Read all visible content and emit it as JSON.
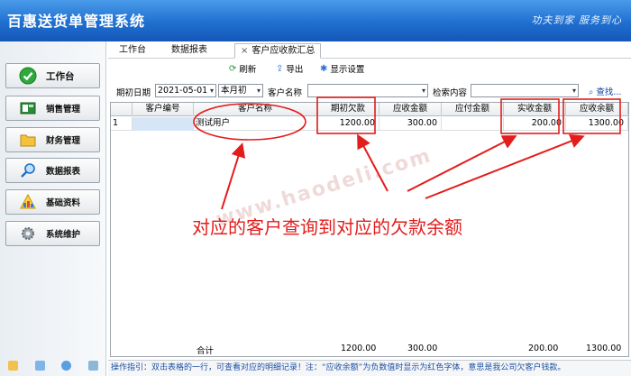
{
  "app": {
    "title": "百惠送货单管理系统",
    "slogan": "功夫到家 服务到心"
  },
  "sidebar": {
    "items": [
      {
        "label": "工作台",
        "icon": "check-circle-icon"
      },
      {
        "label": "销售管理",
        "icon": "sales-icon"
      },
      {
        "label": "财务管理",
        "icon": "folder-icon"
      },
      {
        "label": "数据报表",
        "icon": "magnifier-icon"
      },
      {
        "label": "基础资料",
        "icon": "building-icon"
      },
      {
        "label": "系统维护",
        "icon": "gear-icon"
      }
    ]
  },
  "tabs": [
    {
      "label": "工作台"
    },
    {
      "label": "数据报表"
    },
    {
      "label": "客户应收款汇总",
      "close": "×"
    }
  ],
  "toolbar": {
    "refresh": "刷新",
    "export": "导出",
    "display_settings": "显示设置"
  },
  "filter": {
    "period_label": "期初日期",
    "period_value": "2021-05-01",
    "period_type": "本月初",
    "customer_label": "客户名称",
    "customer_value": "",
    "search_label": "检索内容",
    "search_value": "",
    "search_link": "查找..."
  },
  "table": {
    "columns": [
      "客户编号",
      "客户名称",
      "期初欠款",
      "应收金额",
      "应付金额",
      "实收金额",
      "应收余额"
    ],
    "rows": [
      {
        "index": "1",
        "code": "",
        "name": "测试用户",
        "opening": "1200.00",
        "receivable": "300.00",
        "payable": "",
        "received": "200.00",
        "balance": "1300.00"
      }
    ],
    "totals": {
      "label": "合计",
      "opening": "1200.00",
      "receivable": "300.00",
      "payable": "",
      "received": "200.00",
      "balance": "1300.00"
    }
  },
  "status_text": "操作指引：双击表格的一行，可查看对应的明细记录！注：“应收余额”为负数值时显示为红色字体，意思是我公司欠客户钱款。",
  "annotation": {
    "text": "对应的客户查询到对应的欠款余额",
    "watermark": "www.haodeli.com",
    "color": "#e31c1c"
  }
}
